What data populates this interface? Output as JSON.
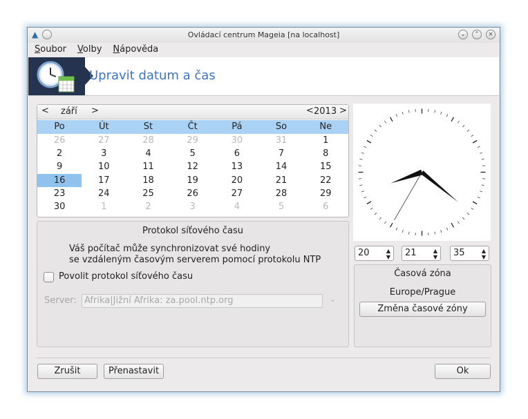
{
  "window": {
    "title": "Ovládací centrum Mageia  [na localhost]"
  },
  "menubar": {
    "items": [
      {
        "mnemonic": "S",
        "rest": "oubor"
      },
      {
        "mnemonic": "V",
        "rest": "olby"
      },
      {
        "mnemonic": "N",
        "rest": "ápověda"
      }
    ]
  },
  "banner": {
    "title": "Upravit datum a čas",
    "icon": "clock-calendar-icon"
  },
  "calendar": {
    "month": "září",
    "year": "2013",
    "prev": "<",
    "next": ">",
    "weekdays": [
      "Po",
      "Út",
      "St",
      "Čt",
      "Pá",
      "So",
      "Ne"
    ],
    "weeks": [
      [
        "26",
        "27",
        "28",
        "29",
        "30",
        "31",
        "1"
      ],
      [
        "2",
        "3",
        "4",
        "5",
        "6",
        "7",
        "8"
      ],
      [
        "9",
        "10",
        "11",
        "12",
        "13",
        "14",
        "15"
      ],
      [
        "16",
        "17",
        "18",
        "19",
        "20",
        "21",
        "22"
      ],
      [
        "23",
        "24",
        "25",
        "26",
        "27",
        "28",
        "29"
      ],
      [
        "30",
        "1",
        "2",
        "3",
        "4",
        "5",
        "6"
      ]
    ],
    "selected_day": "16"
  },
  "time": {
    "hours": "20",
    "minutes": "21",
    "seconds": "35"
  },
  "ntp": {
    "title": "Protokol síťového času",
    "desc_line1": "Váš počítač může synchronizovat své hodiny",
    "desc_line2": "se vzdáleným časovým serverem pomocí protokolu NTP",
    "checkbox_label": "Povolit protokol síťového času",
    "checked": false,
    "server_label": "Server:",
    "server_value": "Afrika|Jižní Afrika: za.pool.ntp.org"
  },
  "timezone": {
    "title": "Časová zóna",
    "value": "Europe/Prague",
    "change_button": "Změna časové zóny"
  },
  "buttons": {
    "cancel": "Zrušit",
    "reset": "Přenastavit",
    "ok": "Ok"
  }
}
